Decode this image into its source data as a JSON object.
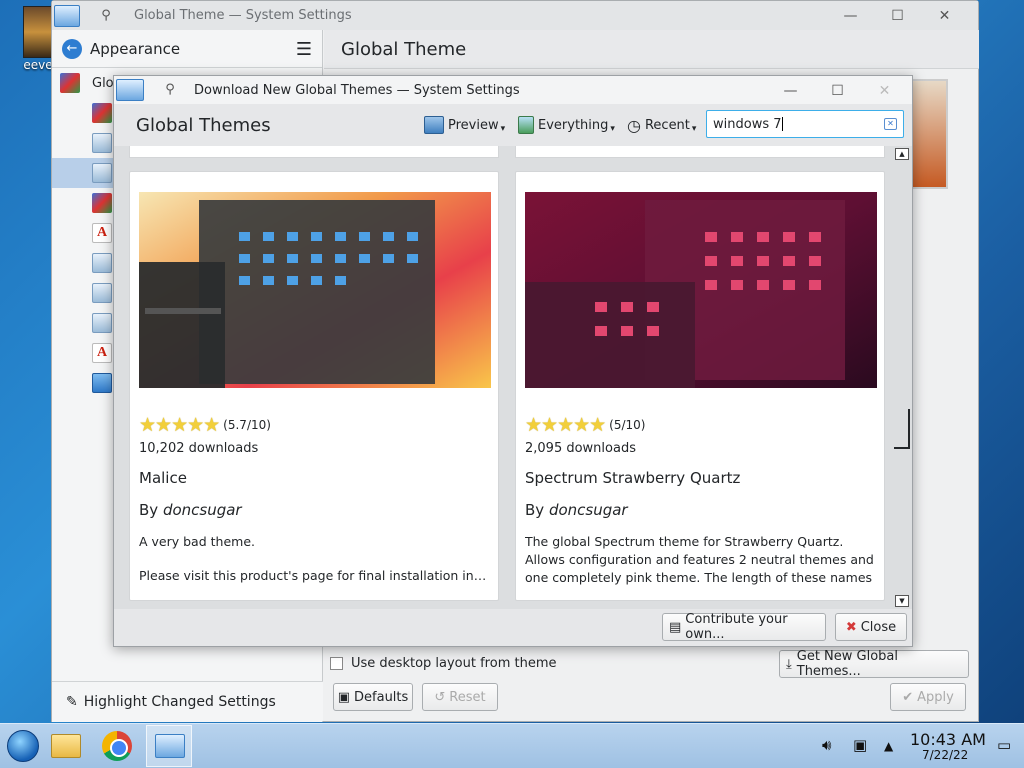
{
  "desktop": {
    "icon_label": "eeve"
  },
  "main_window": {
    "title": "Global Theme — System Settings",
    "controls": {
      "minimize": "—",
      "maximize": "☐",
      "close": "✕"
    },
    "sidebar": {
      "header": "Appearance",
      "first_item": "Glob",
      "footer": "Highlight Changed Settings"
    },
    "content_title": "Global Theme",
    "use_desktop_layout": "Use desktop layout from theme",
    "get_new_button": "Get New Global Themes...",
    "defaults_button": "Defaults",
    "reset_button": "Reset",
    "apply_button": "Apply"
  },
  "dialog": {
    "title": "Download New Global Themes — System Settings",
    "header": "Global Themes",
    "toolbar": {
      "preview": "Preview",
      "everything": "Everything",
      "recent": "Recent"
    },
    "search": {
      "value": "windows 7"
    },
    "cards": [
      {
        "rating": "(5.7/10)",
        "downloads": "10,202 downloads",
        "name": "Malice",
        "by": "By ",
        "author": "doncsugar",
        "desc": "A very bad theme.",
        "desc2": "Please visit this product's page for final installation instr..."
      },
      {
        "rating": "(5/10)",
        "downloads": "2,095 downloads",
        "name": "Spectrum Strawberry Quartz",
        "by": "By ",
        "author": "doncsugar",
        "desc": "The global Spectrum theme for Strawberry Quartz. Allows configuration and features 2 neutral themes and one completely pink theme. The length of these names is ge...",
        "desc2": ""
      }
    ],
    "contribute_button": "Contribute your own...",
    "close_button": "Close"
  },
  "taskbar": {
    "time": "10:43 AM",
    "date": "7/22/22"
  }
}
